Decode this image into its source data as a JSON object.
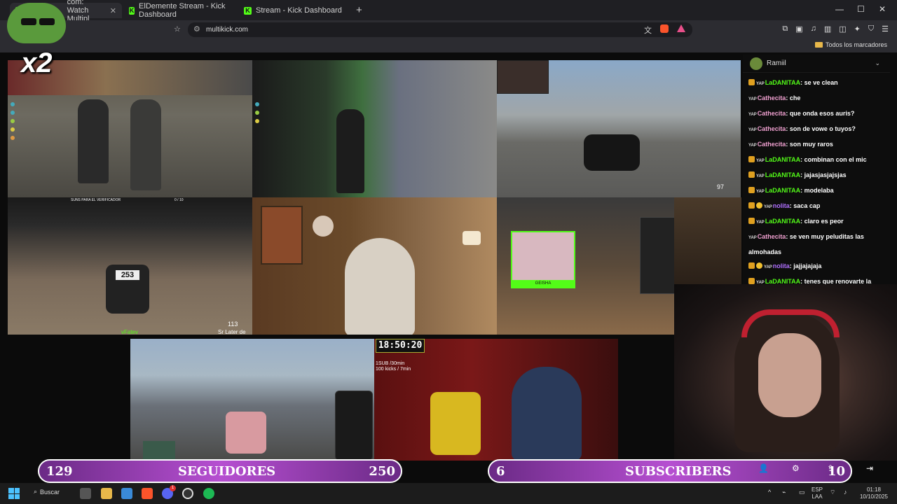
{
  "browser": {
    "tabs": [
      {
        "label": "com: Watch Multipl"
      },
      {
        "label": "ElDemente Stream - Kick Dashboard"
      },
      {
        "label": "Stream - Kick Dashboard"
      }
    ],
    "new_tab": "+",
    "url": "multikick.com",
    "bookmark_folder": "Todos los marcadores",
    "window_controls": [
      "—",
      "☐",
      "✕"
    ]
  },
  "overlay": {
    "multiplier": "x2"
  },
  "streams": {
    "hud_top_left": "SUNS PARA EL VERIFICADOR",
    "hud_counter": "0 / 10",
    "car_number": "253",
    "speed": "113",
    "streamer_tag": "vFatev",
    "streamer_tag2": "Sr Later de odio",
    "speed2": "97",
    "timer": "18:50:20",
    "sub_info_1": "1SUB /30min",
    "sub_info_2": "100 kicks / 7min",
    "cam_label": "GEISHA"
  },
  "chat": {
    "channel": "Ramiil",
    "messages": [
      {
        "user": "LaDANITAA",
        "text": "se ve clean",
        "badge": "sub",
        "color": "#53fc18"
      },
      {
        "user": "Cathecita",
        "text": "che",
        "badge": "none",
        "color": "#f0a0d0"
      },
      {
        "user": "Cathecita",
        "text": "que onda esos auris?",
        "badge": "none",
        "color": "#f0a0d0"
      },
      {
        "user": "Cathecita",
        "text": "son de vowe o tuyos?",
        "badge": "none",
        "color": "#f0a0d0"
      },
      {
        "user": "Cathecita",
        "text": "son muy raros",
        "badge": "none",
        "color": "#f0a0d0"
      },
      {
        "user": "LaDANITAA",
        "text": "combinan con el mic",
        "badge": "sub",
        "color": "#53fc18"
      },
      {
        "user": "LaDANITAA",
        "text": "jajasjasjajsjas",
        "badge": "sub",
        "color": "#53fc18"
      },
      {
        "user": "LaDANITAA",
        "text": "modelaba",
        "badge": "sub",
        "color": "#53fc18"
      },
      {
        "user": "nolita",
        "text": "saca cap",
        "badge": "gift",
        "color": "#b070ff"
      },
      {
        "user": "LaDANITAA",
        "text": "claro es peor",
        "badge": "sub",
        "color": "#53fc18"
      },
      {
        "user": "Cathecita",
        "text": "se ven muy peluditas las almohadas",
        "badge": "none",
        "color": "#f0a0d0"
      },
      {
        "user": "nolita",
        "text": "jajjajajaja",
        "badge": "gift",
        "color": "#b070ff"
      },
      {
        "user": "LaDANITAA",
        "text": "tenes que renovarte la manteca de cacao",
        "badge": "sub",
        "color": "#53fc18"
      }
    ],
    "yap_label": "YAP"
  },
  "goals": {
    "followers": {
      "current": "129",
      "label": "SEGUIDORES",
      "target": "250",
      "progress": 0.516
    },
    "subs": {
      "current": "6",
      "label": "SUBSCRIBERS",
      "target": "10",
      "progress": 0.6
    }
  },
  "taskbar": {
    "search_label": "Buscar",
    "lang_1": "ESP",
    "lang_2": "LAA",
    "time": "01:18",
    "date": "10/10/2025",
    "discord_badge": "1"
  },
  "colors": {
    "kick_green": "#53fc18",
    "goal_purple": "#b64fd1"
  }
}
